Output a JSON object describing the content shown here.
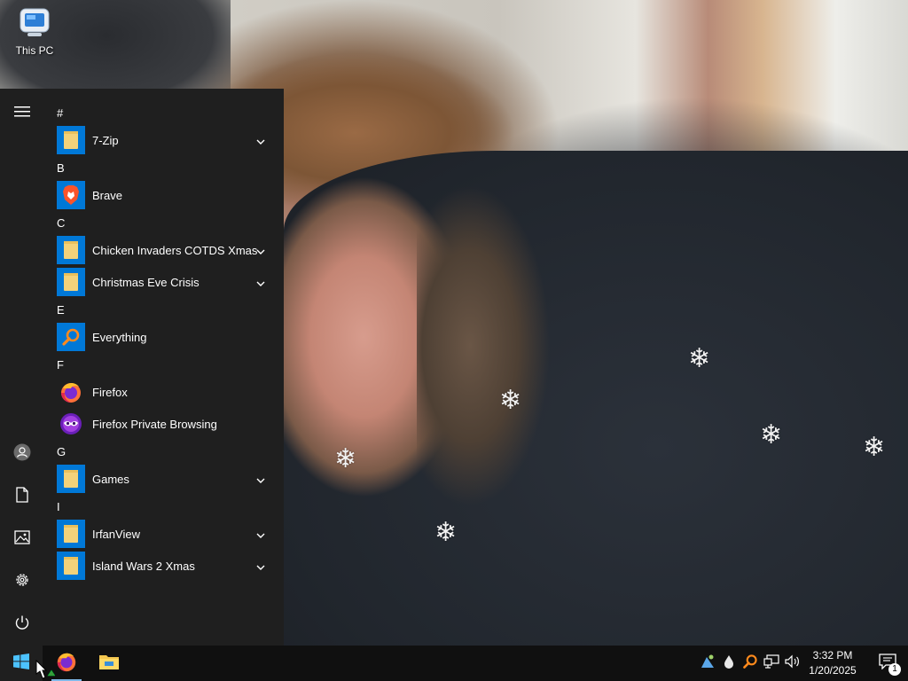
{
  "desktop": {
    "icons": [
      {
        "label": "This PC",
        "icon": "this-pc-icon"
      }
    ]
  },
  "start_menu": {
    "rail": {
      "items": [
        {
          "name": "hamburger-menu",
          "icon": "hamburger-icon"
        },
        {
          "name": "user-account",
          "icon": "user-icon"
        },
        {
          "name": "documents",
          "icon": "document-icon"
        },
        {
          "name": "pictures",
          "icon": "pictures-icon"
        },
        {
          "name": "settings",
          "icon": "gear-icon"
        },
        {
          "name": "power",
          "icon": "power-icon"
        }
      ]
    },
    "groups": [
      {
        "letter": "#",
        "apps": [
          {
            "label": "7-Zip",
            "icon": "folder-icon",
            "expandable": true
          }
        ]
      },
      {
        "letter": "B",
        "apps": [
          {
            "label": "Brave",
            "icon": "brave-icon",
            "expandable": false
          }
        ]
      },
      {
        "letter": "C",
        "apps": [
          {
            "label": "Chicken Invaders COTDS Xmas",
            "icon": "folder-icon",
            "expandable": true
          },
          {
            "label": "Christmas Eve Crisis",
            "icon": "folder-icon",
            "expandable": true
          }
        ]
      },
      {
        "letter": "E",
        "apps": [
          {
            "label": "Everything",
            "icon": "search-magnifier-icon",
            "expandable": false
          }
        ]
      },
      {
        "letter": "F",
        "apps": [
          {
            "label": "Firefox",
            "icon": "firefox-icon",
            "expandable": false
          },
          {
            "label": "Firefox Private Browsing",
            "icon": "firefox-private-icon",
            "expandable": false
          }
        ]
      },
      {
        "letter": "G",
        "apps": [
          {
            "label": "Games",
            "icon": "folder-icon",
            "expandable": true
          }
        ]
      },
      {
        "letter": "I",
        "apps": [
          {
            "label": "IrfanView",
            "icon": "folder-icon",
            "expandable": true
          },
          {
            "label": "Island Wars 2 Xmas",
            "icon": "folder-icon",
            "expandable": true
          }
        ]
      }
    ]
  },
  "taskbar": {
    "start_icon": "windows-logo-icon",
    "pinned": [
      {
        "name": "firefox",
        "icon": "firefox-icon"
      },
      {
        "name": "file-explorer",
        "icon": "file-explorer-icon"
      }
    ],
    "tray": [
      {
        "name": "tray-app",
        "icon": "tray-app-icon"
      },
      {
        "name": "tray-drop",
        "icon": "water-drop-icon"
      },
      {
        "name": "tray-everything",
        "icon": "search-magnifier-icon"
      },
      {
        "name": "tray-network",
        "icon": "network-icon"
      },
      {
        "name": "tray-volume",
        "icon": "volume-icon"
      }
    ],
    "clock": {
      "time": "3:32 PM",
      "date": "1/20/2025"
    },
    "notifications": {
      "count": "1",
      "icon": "action-center-icon"
    }
  },
  "colors": {
    "start_bg": "#1f1f1f",
    "taskbar_bg": "#101010",
    "tile_blue": "#0078d7",
    "folder_yellow": "#f3d27a"
  }
}
